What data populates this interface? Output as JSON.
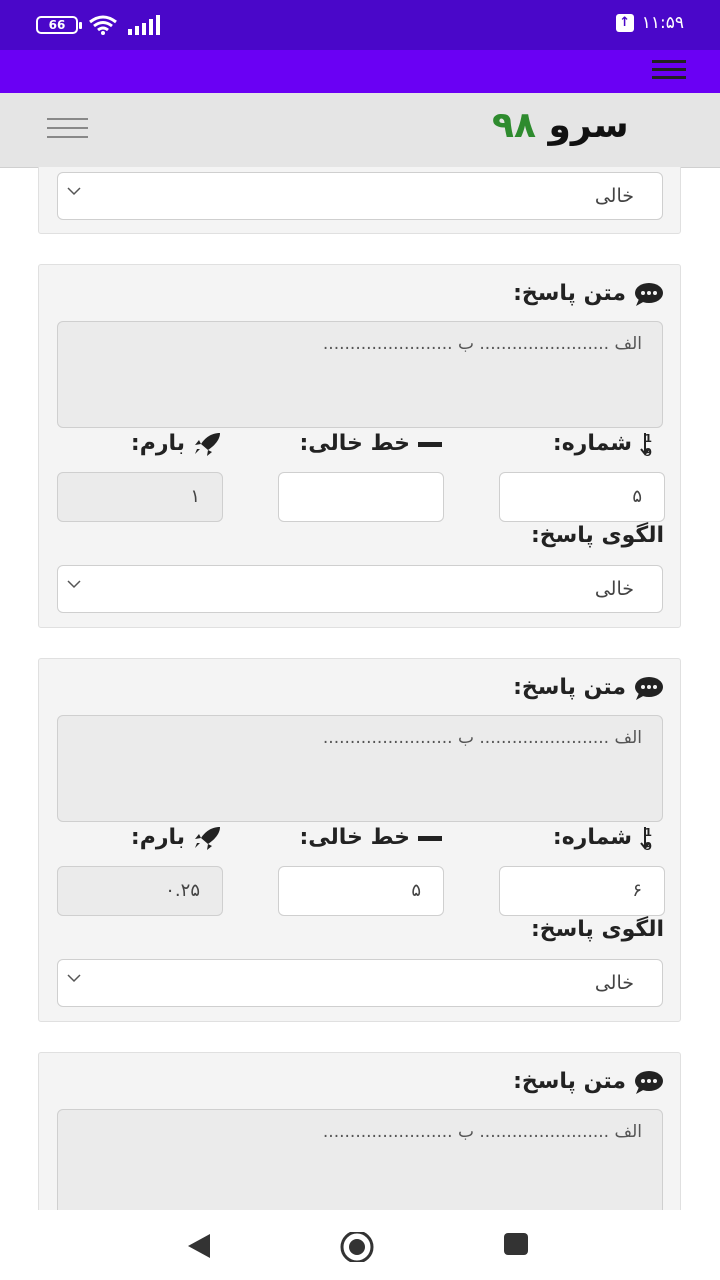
{
  "status_bar": {
    "battery": "66",
    "time": "۱۱:۵۹"
  },
  "header": {
    "logo_word": "سرو",
    "logo_number": "۹۸"
  },
  "top_select": {
    "value": "خالی"
  },
  "cards": [
    {
      "answer_text_label": "متن پاسخ:",
      "answer_text": "الف ........................ ب ........................",
      "number_label": "شماره:",
      "blank_label": "خط خالی:",
      "score_label": "بارم:",
      "number_value": "۵",
      "blank_value": "",
      "score_value": "۱",
      "pattern_label": "الگوی پاسخ:",
      "pattern_value": "خالی"
    },
    {
      "answer_text_label": "متن پاسخ:",
      "answer_text": "الف ........................ ب ........................",
      "number_label": "شماره:",
      "blank_label": "خط خالی:",
      "score_label": "بارم:",
      "number_value": "۶",
      "blank_value": "۵",
      "score_value": "۰.۲۵",
      "pattern_label": "الگوی پاسخ:",
      "pattern_value": "خالی"
    },
    {
      "answer_text_label": "متن پاسخ:",
      "answer_text": "الف ........................ ب ........................"
    }
  ],
  "colors": {
    "status_bar": "#4a07c9",
    "nav_bar": "#6a00f4",
    "logo_number": "#2e8b2e"
  },
  "icons": [
    "comment-icon",
    "sort-numeric-icon",
    "minus-icon",
    "rocket-icon",
    "chevron-down-icon",
    "hamburger-icon",
    "back-icon",
    "home-icon",
    "recents-icon"
  ]
}
